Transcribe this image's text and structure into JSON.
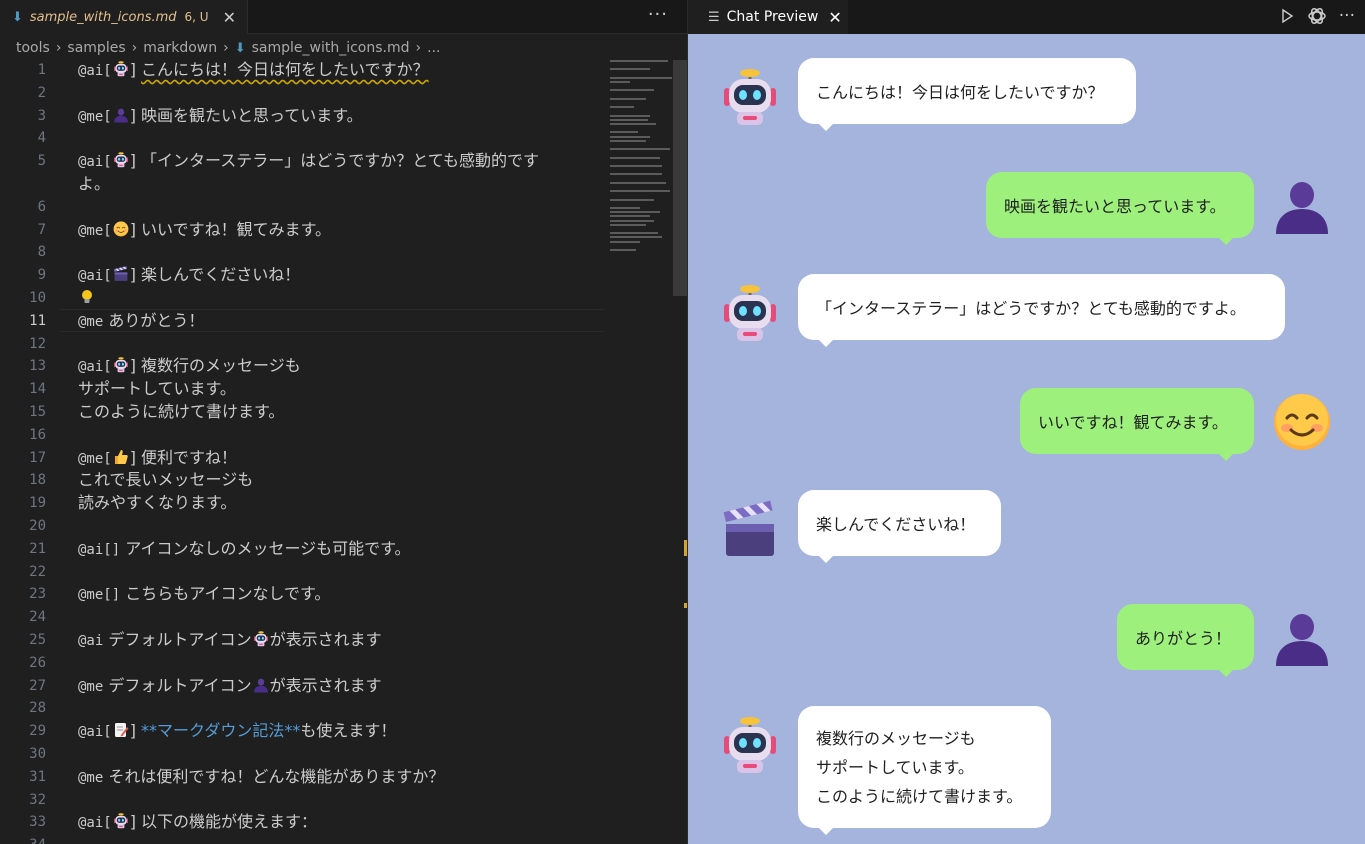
{
  "editor": {
    "tab": {
      "filename": "sample_with_icons.md",
      "status": "6, U",
      "close": "✕"
    },
    "more": "···",
    "breadcrumb": [
      "tools",
      "samples",
      "markdown",
      "sample_with_icons.md",
      "..."
    ],
    "active_line": 11,
    "lines": [
      {
        "n": "1",
        "segs": [
          {
            "t": "@ai["
          },
          {
            "icon": "robot"
          },
          {
            "t": "] "
          },
          {
            "t": "こんにちは！今日は何をしたいですか？",
            "squig": true
          }
        ]
      },
      {
        "n": "2",
        "segs": []
      },
      {
        "n": "3",
        "segs": [
          {
            "t": "@me["
          },
          {
            "icon": "person"
          },
          {
            "t": "] 映画を観たいと思っています。"
          }
        ]
      },
      {
        "n": "4",
        "segs": []
      },
      {
        "n": "5",
        "segs": [
          {
            "t": "@ai["
          },
          {
            "icon": "robot"
          },
          {
            "t": "] 「インターステラー」はどうですか？とても感動的です"
          }
        ]
      },
      {
        "n": "",
        "segs": [
          {
            "t": "よ。"
          }
        ]
      },
      {
        "n": "6",
        "segs": []
      },
      {
        "n": "7",
        "segs": [
          {
            "t": "@me["
          },
          {
            "icon": "smile"
          },
          {
            "t": "] いいですね！観てみます。"
          }
        ]
      },
      {
        "n": "8",
        "segs": []
      },
      {
        "n": "9",
        "segs": [
          {
            "t": "@ai["
          },
          {
            "icon": "clapper"
          },
          {
            "t": "] 楽しんでくださいね！"
          }
        ]
      },
      {
        "n": "10",
        "segs": [
          {
            "icon": "bulb"
          }
        ]
      },
      {
        "n": "11",
        "segs": [
          {
            "t": "@me ありがとう！"
          }
        ]
      },
      {
        "n": "12",
        "segs": []
      },
      {
        "n": "13",
        "segs": [
          {
            "t": "@ai["
          },
          {
            "icon": "robot"
          },
          {
            "t": "] 複数行のメッセージも"
          }
        ]
      },
      {
        "n": "14",
        "segs": [
          {
            "t": "サポートしています。"
          }
        ]
      },
      {
        "n": "15",
        "segs": [
          {
            "t": "このように続けて書けます。"
          }
        ]
      },
      {
        "n": "16",
        "segs": []
      },
      {
        "n": "17",
        "segs": [
          {
            "t": "@me["
          },
          {
            "icon": "thumb"
          },
          {
            "t": "] 便利ですね！"
          }
        ]
      },
      {
        "n": "18",
        "segs": [
          {
            "t": "これで長いメッセージも"
          }
        ]
      },
      {
        "n": "19",
        "segs": [
          {
            "t": "読みやすくなります。"
          }
        ]
      },
      {
        "n": "20",
        "segs": []
      },
      {
        "n": "21",
        "segs": [
          {
            "t": "@ai[] アイコンなしのメッセージも可能です。"
          }
        ]
      },
      {
        "n": "22",
        "segs": []
      },
      {
        "n": "23",
        "segs": [
          {
            "t": "@me[] こちらもアイコンなしです。"
          }
        ]
      },
      {
        "n": "24",
        "segs": []
      },
      {
        "n": "25",
        "segs": [
          {
            "t": "@ai デフォルトアイコン"
          },
          {
            "icon": "robot"
          },
          {
            "t": "が表示されます"
          }
        ]
      },
      {
        "n": "26",
        "segs": []
      },
      {
        "n": "27",
        "segs": [
          {
            "t": "@me デフォルトアイコン"
          },
          {
            "icon": "person"
          },
          {
            "t": "が表示されます"
          }
        ]
      },
      {
        "n": "28",
        "segs": []
      },
      {
        "n": "29",
        "segs": [
          {
            "t": "@ai["
          },
          {
            "icon": "memo"
          },
          {
            "t": "] "
          },
          {
            "t": "**マークダウン記法**",
            "md": true
          },
          {
            "t": "も使えます！"
          }
        ]
      },
      {
        "n": "30",
        "segs": []
      },
      {
        "n": "31",
        "segs": [
          {
            "t": "@me それは便利ですね！どんな機能がありますか？"
          }
        ]
      },
      {
        "n": "32",
        "segs": []
      },
      {
        "n": "33",
        "segs": [
          {
            "t": "@ai["
          },
          {
            "icon": "robot"
          },
          {
            "t": "] 以下の機能が使えます："
          }
        ]
      },
      {
        "n": "34",
        "segs": []
      }
    ]
  },
  "preview": {
    "tab": {
      "title": "Chat Preview",
      "close": "✕"
    },
    "messages": [
      {
        "role": "ai",
        "icon": "robot",
        "lines": [
          "こんにちは！今日は何をしたいですか？"
        ]
      },
      {
        "role": "me",
        "icon": "person",
        "lines": [
          "映画を観たいと思っています。"
        ]
      },
      {
        "role": "ai",
        "icon": "robot",
        "lines": [
          "「インターステラー」はどうですか？とても感動的ですよ。"
        ]
      },
      {
        "role": "me",
        "icon": "smile",
        "lines": [
          "いいですね！観てみます。"
        ]
      },
      {
        "role": "ai",
        "icon": "clapper",
        "lines": [
          "楽しんでくださいね！"
        ]
      },
      {
        "role": "me",
        "icon": "person",
        "lines": [
          "ありがとう！"
        ]
      },
      {
        "role": "ai",
        "icon": "robot",
        "lines": [
          "複数行のメッセージも",
          "サポートしています。",
          "このように続けて書けます。"
        ]
      }
    ]
  },
  "colors": {
    "preview_bg": "#a5b4dc",
    "ai_bubble": "#ffffff",
    "me_bubble": "#9ef07c",
    "markdown_text": "#569cd6",
    "modified_tab": "#e2c08d"
  }
}
